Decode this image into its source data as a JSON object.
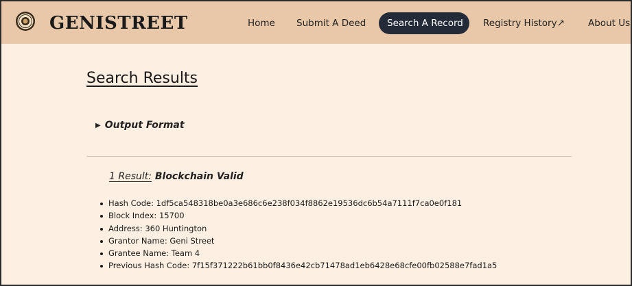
{
  "brand": {
    "name": "GENISTREET",
    "logo_icon": "seal-icon"
  },
  "nav": {
    "items": [
      {
        "label": "Home",
        "active": false
      },
      {
        "label": "Submit A Deed",
        "active": false
      },
      {
        "label": "Search A Record",
        "active": true
      },
      {
        "label": "Registry History↗",
        "active": false
      },
      {
        "label": "About Us",
        "active": false
      }
    ]
  },
  "main": {
    "title": "Search Results",
    "output_format_label": "Output Format",
    "result_count_label": "1 Result:",
    "result_status": "Blockchain Valid",
    "fields": [
      "Hash Code: 1df5ca548318be0a3e686c6e238f034f8862e19536dc6b54a7111f7ca0e0f181",
      "Block Index: 15700",
      "Address: 360 Huntington",
      "Grantor Name: Geni Street",
      "Grantee Name: Team 4",
      "Previous Hash Code: 7f15f371222b61bb0f8436e42cb71478ad1eb6428e68cfe00fb02588e7fad1a5"
    ]
  },
  "colors": {
    "navbar_bg": "#e9c8a9",
    "page_bg": "#fdf0e2",
    "active_pill": "#232a38"
  }
}
